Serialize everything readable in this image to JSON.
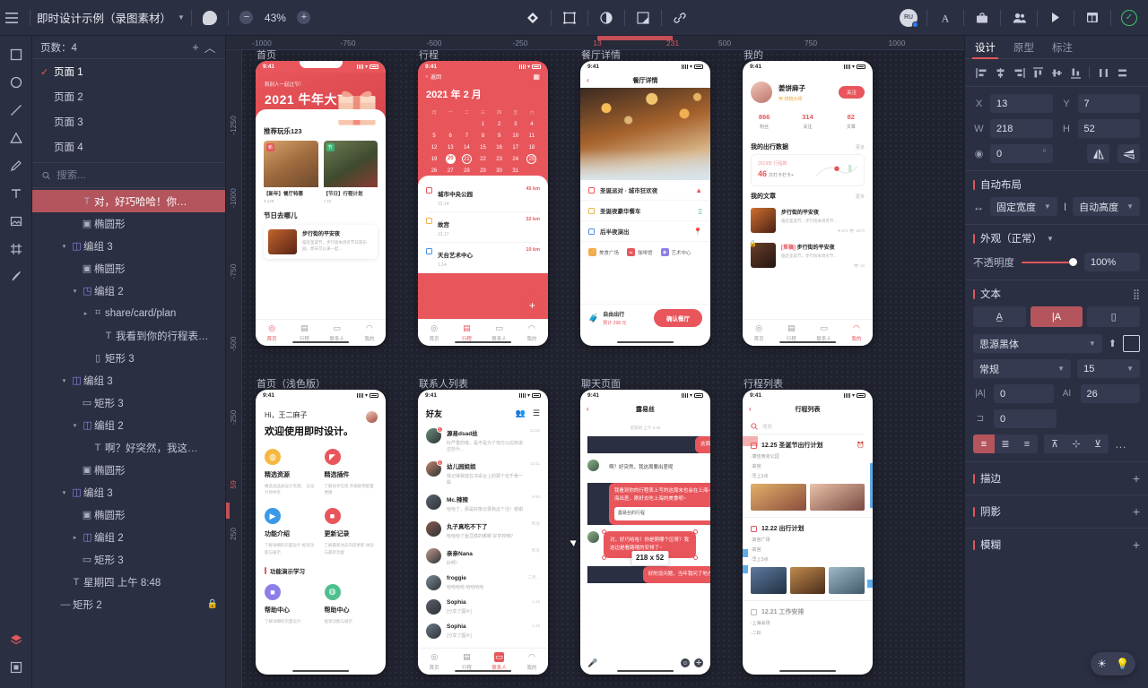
{
  "topbar": {
    "menu_icon": "hamburger-icon",
    "doc_title": "即时设计示例（录图素材）",
    "zoom": "43%",
    "zoom_out": "−",
    "zoom_in": "+",
    "icons": [
      "comment-bubble-icon",
      "diamond-icon",
      "frame-icon",
      "contrast-icon",
      "export-icon",
      "link-icon"
    ],
    "avatar_initials": "RU",
    "right_icons": [
      "text-icon",
      "toolbox-icon",
      "members-icon",
      "play-icon",
      "layout-icon",
      "check-circle-icon"
    ]
  },
  "rail": {
    "tools": [
      "move-tool",
      "ellipse-tool",
      "line-tool",
      "triangle-tool",
      "pen-tool",
      "text-tool",
      "image-tool",
      "frame-tool",
      "brush-tool"
    ],
    "bottom_tools": [
      "layers-tool",
      "components-tool"
    ]
  },
  "layers": {
    "pages_label": "页数：4",
    "add_page": "+",
    "collapse": "︿",
    "pages": [
      {
        "label": "页面 1",
        "active": true
      },
      {
        "label": "页面 2",
        "active": false
      },
      {
        "label": "页面 3",
        "active": false
      },
      {
        "label": "页面 4",
        "active": false
      }
    ],
    "search_placeholder": "搜索...",
    "tree": [
      {
        "depth": 3,
        "arrow": "",
        "icon": "T",
        "label": "对，好巧哈哈！你…",
        "selected": true
      },
      {
        "depth": 3,
        "arrow": "",
        "icon": "img",
        "label": "椭圆形",
        "selected": false
      },
      {
        "depth": 2,
        "arrow": "▾",
        "icon": "grp",
        "label": "编组 3",
        "selected": false
      },
      {
        "depth": 3,
        "arrow": "",
        "icon": "img",
        "label": "椭圆形",
        "selected": false
      },
      {
        "depth": 3,
        "arrow": "▾",
        "icon": "cmp",
        "label": "编组 2",
        "selected": false
      },
      {
        "depth": 4,
        "arrow": "▸",
        "icon": "ins",
        "label": "share/card/plan",
        "selected": false
      },
      {
        "depth": 5,
        "arrow": "",
        "icon": "T",
        "label": "我看到你的行程表…",
        "selected": false
      },
      {
        "depth": 4,
        "arrow": "",
        "icon": "rct",
        "label": "矩形 3",
        "selected": false
      },
      {
        "depth": 2,
        "arrow": "▾",
        "icon": "grp",
        "label": "编组 3",
        "selected": false
      },
      {
        "depth": 3,
        "arrow": "",
        "icon": "sqr",
        "label": "矩形 3",
        "selected": false
      },
      {
        "depth": 3,
        "arrow": "▾",
        "icon": "grp",
        "label": "编组 2",
        "selected": false
      },
      {
        "depth": 4,
        "arrow": "",
        "icon": "T",
        "label": "啊？好突然，我这…",
        "selected": false
      },
      {
        "depth": 3,
        "arrow": "",
        "icon": "img",
        "label": "椭圆形",
        "selected": false
      },
      {
        "depth": 2,
        "arrow": "▾",
        "icon": "grp",
        "label": "编组 3",
        "selected": false
      },
      {
        "depth": 3,
        "arrow": "",
        "icon": "img",
        "label": "椭圆形",
        "selected": false
      },
      {
        "depth": 3,
        "arrow": "▸",
        "icon": "grp",
        "label": "编组 2",
        "selected": false
      },
      {
        "depth": 3,
        "arrow": "",
        "icon": "sqr",
        "label": "矩形 3",
        "selected": false
      },
      {
        "depth": 2,
        "arrow": "",
        "icon": "T",
        "label": "星期四 上午 8:48",
        "selected": false
      },
      {
        "depth": 1,
        "arrow": "",
        "icon": "lin",
        "label": "矩形 2",
        "selected": false,
        "locked": true
      }
    ]
  },
  "ruler": {
    "h_ticks": [
      "-1000",
      "-750",
      "-500",
      "-250",
      "13",
      "231",
      "500",
      "750",
      "1000"
    ],
    "v_ticks": [
      "-1250",
      "-1000",
      "-750",
      "-500",
      "-250",
      "59",
      "250"
    ],
    "highlight_start": "13",
    "highlight_end": "231",
    "v_highlight": "59"
  },
  "artboards": [
    {
      "name": "首页"
    },
    {
      "name": "行程"
    },
    {
      "name": "餐厅详情"
    },
    {
      "name": "我的"
    },
    {
      "name": "首页（浅色版）"
    },
    {
      "name": "联系人列表"
    },
    {
      "name": "聊天页面"
    },
    {
      "name": "行程列表"
    }
  ],
  "screens": {
    "home": {
      "time": "9:41",
      "hero_small": "和别人一起过节！",
      "hero_big": "2021 牛年大吉",
      "section": "推荐玩乐123",
      "cards": [
        {
          "tag": "【新年】",
          "caption": "【新年】餐厅特惠",
          "sub": "¥ 129"
        },
        {
          "tag": "【节日】",
          "caption": "【节日】行程计划",
          "sub": "¥ 22"
        }
      ],
      "section2": "节日去哪儿",
      "list_item": {
        "title": "步行街的平安夜",
        "desc": "临近圣诞节，步行街本周有节日游乐园，想去可以来一起…"
      },
      "tabs": [
        "首页",
        "行程",
        "联系人",
        "我的"
      ]
    },
    "calendar": {
      "time": "9:41",
      "back": "返回",
      "month": "2021 年 2 月",
      "weekdays": [
        "日",
        "一",
        "二",
        "三",
        "四",
        "五",
        "六"
      ],
      "selected_day": "20",
      "ring_days": [
        "21",
        "25"
      ],
      "schedule": [
        {
          "name": "城市中央公园",
          "date": "12.14",
          "km": "45 km"
        },
        {
          "name": "故宫",
          "date": "12.17",
          "km": "32 km"
        },
        {
          "name": "天台艺术中心",
          "date": "1.14",
          "km": "10 km"
        }
      ],
      "fab": "+",
      "tabs": [
        "首页",
        "行程",
        "联系人",
        "我的"
      ]
    },
    "restaurant": {
      "time": "9:41",
      "title": "餐厅详情",
      "options": [
        {
          "name": "圣诞派对 · 城市狂欢夜",
          "icon": "umbrella-icon"
        },
        {
          "name": "圣诞夜豪华餐车",
          "icon": "bag-icon"
        },
        {
          "name": "后半夜演出",
          "icon": "pin-icon"
        }
      ],
      "chips": [
        "美食广场",
        "咖啡馆",
        "艺术中心"
      ],
      "pay_label": "自由出行",
      "pay_price": "预计 298 元",
      "confirm": "确认餐厅"
    },
    "profile": {
      "time": "9:41",
      "name": "姜饼麻子",
      "tag": "甲 烘焙大师",
      "follow": "关注",
      "stats": [
        {
          "v": "866",
          "k": "粉丝"
        },
        {
          "v": "314",
          "k": "关注"
        },
        {
          "v": "82",
          "k": "文章"
        }
      ],
      "data_title": "我的出行数据",
      "more": "更多",
      "data_l1": "2019年 行程数",
      "data_num": "46",
      "data_unit": "次打卡打卡+",
      "art_title": "我的文章",
      "articles": [
        {
          "title": "步行街的平安夜",
          "desc": "临近圣诞节，步行街本周有节…",
          "meta": "♥ 272   👁 1873"
        },
        {
          "title": "步行街的平安夜",
          "badge": "[草稿]",
          "desc": "临近圣诞节，步行街本周有节…",
          "meta": "👁 12"
        }
      ],
      "tabs": [
        "首页",
        "行程",
        "联系人",
        "我的"
      ]
    },
    "light_home": {
      "time": "9:41",
      "greeting": "Hi，王二麻子",
      "headline": "欢迎使用即时设计。",
      "features": [
        {
          "name": "精选资源",
          "desc": "精选高品质设计资源，\n与设计师共享"
        },
        {
          "name": "精选插件",
          "desc": "了解动手实现\n开箱即用配置便捷"
        },
        {
          "name": "功能介绍",
          "desc": "了解详细的页面设计\n框架功能与展示"
        },
        {
          "name": "更新记录",
          "desc": "了解最新动态内容更新\n体验与最新功能"
        }
      ],
      "section": "功能演示学习",
      "features2": [
        {
          "name": "帮助中心",
          "desc": "了解详细的页面设计"
        },
        {
          "name": "帮助中心",
          "desc": "框架功能与展示"
        }
      ]
    },
    "contacts": {
      "time": "9:41",
      "title": "好友",
      "rows": [
        {
          "name": "源易dsad丝",
          "msg": "好严重的噢，是不是为了地方以后知道这些什…",
          "time": "13:22",
          "badge": "1"
        },
        {
          "name": "幼儿园姐姐",
          "msg": "我记得我放在书桌台上的那个花千骨一般",
          "time": "12:11",
          "badge": "1"
        },
        {
          "name": "Mc.辣辣",
          "msg": "哈哈了，那是好像记录我这个活！谢谢",
          "time": "9:40",
          "badge": ""
        },
        {
          "name": "丸子真吃不下了",
          "msg": "哈哈哈了鱼豆腐的哪哪 好学校哦？",
          "time": "昨天",
          "badge": ""
        },
        {
          "name": "亲亲Nana",
          "msg": "好啊！",
          "time": "昨天",
          "badge": ""
        },
        {
          "name": "froggie",
          "msg": "哈哈哈哈 哈哈哈哈",
          "time": "二月…",
          "badge": ""
        },
        {
          "name": "Sophia",
          "msg": "[分享了图片]",
          "time": "1.12",
          "badge": ""
        },
        {
          "name": "Sophia",
          "msg": "[分享了图片]",
          "time": "1.12",
          "badge": ""
        }
      ],
      "tabs": [
        "首页",
        "行程",
        "联系人",
        "我的"
      ]
    },
    "chat": {
      "time": "9:41",
      "title": "露易丝",
      "timestamp": "星期四 上午 8:48",
      "messages": [
        {
          "side": "me",
          "text": "这周末一起去吃点吗？"
        },
        {
          "side": "you",
          "text": "啊？好突然，我这周要出差呢"
        },
        {
          "side": "me",
          "text": "我看到你的行程表上写的这周末也会在上海~我这周也要去上海出差，刚好去吃上海的美食呗~",
          "quote": "露易丝的行程"
        },
        {
          "side": "you",
          "text": "对，好巧哈哈！你是刚哪个区呀？我这边是看路哦的安排了~",
          "selected": true
        },
        {
          "side": "me",
          "text": "好的没问题，当年我问了地方以后发哦地址你~"
        }
      ],
      "selection_size": "218 x 52",
      "mic_icon": "mic-icon"
    },
    "trip_list": {
      "time": "9:41",
      "title": "行程列表",
      "search_placeholder": "搜索",
      "trips": [
        {
          "date": "12.25",
          "name": "圣诞节出行计划",
          "items": [
            "·康佳西克公园",
            "·故宫",
            "·早上3点"
          ],
          "images": 2,
          "bell": true
        },
        {
          "date": "12.22",
          "name": "出行计划",
          "items": [
            "·故宫广场",
            "·故宫",
            "·早上3点"
          ],
          "images": 3,
          "bell": false
        },
        {
          "date": "12.21",
          "name": "工作安排",
          "items": [
            "·上海会场",
            "·二标"
          ],
          "images": 0,
          "bell": false
        }
      ]
    }
  },
  "right_panel": {
    "tabs": [
      {
        "label": "设计",
        "active": true
      },
      {
        "label": "原型",
        "active": false
      },
      {
        "label": "标注",
        "active": false
      }
    ],
    "align_icons": [
      "align-left-icon",
      "align-center-h-icon",
      "align-right-icon",
      "align-top-icon",
      "align-middle-v-icon",
      "align-bottom-icon",
      "distribute-h-icon",
      "distribute-v-icon"
    ],
    "geometry": {
      "x_label": "X",
      "x": "13",
      "y_label": "Y",
      "y": "7",
      "w_label": "W",
      "w": "218",
      "h_label": "H",
      "h": "52",
      "rotation": "0",
      "rotation_unit": "°",
      "flip_h": "flip-horizontal-icon",
      "flip_v": "flip-vertical-icon"
    },
    "autolayout": {
      "title": "自动布局",
      "width_mode": "固定宽度",
      "height_mode": "自动高度"
    },
    "appearance": {
      "title": "外观（正常）",
      "opacity_label": "不透明度",
      "opacity": "100",
      "opacity_unit": "%"
    },
    "text": {
      "title": "文本",
      "modes": [
        "auto-width-icon",
        "auto-height-icon",
        "fixed-size-icon"
      ],
      "active_mode": 1,
      "font_family": "思源黑体",
      "font_weight": "常规",
      "font_size": "15",
      "letter_spacing_label": "|A|",
      "letter_spacing": "0",
      "line_height_label": "AI",
      "line_height": "26",
      "paragraph_label": "⊐",
      "paragraph_spacing": "0",
      "h_align": [
        "align-text-left-icon",
        "align-text-center-icon",
        "align-text-right-icon"
      ],
      "h_align_active": 0,
      "v_align": [
        "valign-top-icon",
        "valign-middle-icon",
        "valign-bottom-icon"
      ],
      "more": "…"
    },
    "sections": [
      {
        "title": "描边",
        "add": "+"
      },
      {
        "title": "阴影",
        "add": "+"
      },
      {
        "title": "模糊",
        "add": "+"
      }
    ]
  },
  "theme_toggle": {
    "sun": "sun-icon",
    "bulb": "bulb-icon"
  },
  "colors": {
    "accent_red": "#e8565c",
    "panel_bg": "#2b2f42",
    "canvas_bg": "#20232f",
    "selection": "#b4545c"
  }
}
